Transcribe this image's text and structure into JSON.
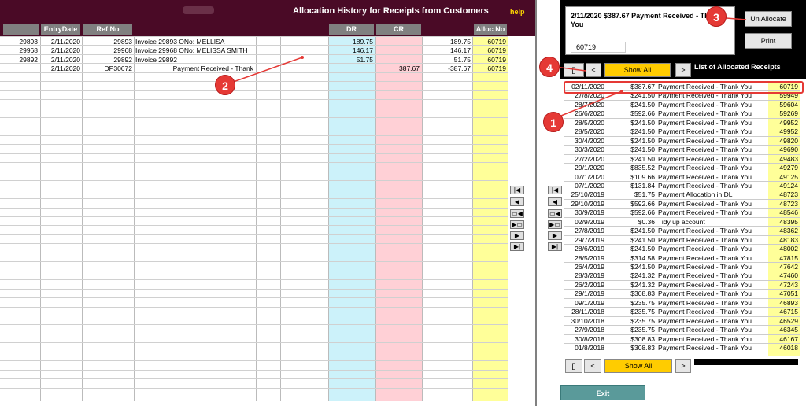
{
  "header": {
    "title": "Allocation History for Receipts from Customers",
    "help": "help"
  },
  "columns": {
    "entry_date": "EntryDate",
    "ref_no": "Ref No",
    "dr": "DR",
    "cr": "CR",
    "alloc_no": "Alloc No"
  },
  "left_rows": [
    {
      "id": "29893",
      "date": "2/11/2020",
      "ref": "29893",
      "desc": "Invoice 29893 ONo: MELLISA",
      "dr": "189.75",
      "cr": "",
      "bal": "189.75",
      "alloc": "60719"
    },
    {
      "id": "29968",
      "date": "2/11/2020",
      "ref": "29968",
      "desc": "Invoice 29968 ONo: MELISSA SMITH",
      "dr": "146.17",
      "cr": "",
      "bal": "146.17",
      "alloc": "60719"
    },
    {
      "id": "29892",
      "date": "2/11/2020",
      "ref": "29892",
      "desc": "Invoice 29892",
      "dr": "51.75",
      "cr": "",
      "bal": "51.75",
      "alloc": "60719"
    },
    {
      "id": "",
      "date": "2/11/2020",
      "ref": "DP30672",
      "desc": "Payment Received - Thank",
      "dr": "",
      "cr": "387.67",
      "bal": "-387.67",
      "alloc": "60719"
    }
  ],
  "info": {
    "line1": "2/11/2020 $387.67 Payment Received - Thank",
    "line2": "You",
    "alloc_value": "60719"
  },
  "buttons": {
    "unallocate": "Un Allocate",
    "print": "Print",
    "bracket": "[]",
    "less": "<",
    "show_all": "Show All",
    "greater": ">",
    "exit": "Exit"
  },
  "list_title": "List of Allocated Receipts",
  "receipts": [
    {
      "date": "02/11/2020",
      "amt": "$387.67",
      "desc": "Payment Received - Thank You",
      "alloc": "60719"
    },
    {
      "date": "27/8/2020",
      "amt": "$241.50",
      "desc": "Payment Received - Thank You",
      "alloc": "59949"
    },
    {
      "date": "28/7/2020",
      "amt": "$241.50",
      "desc": "Payment Received - Thank You",
      "alloc": "59604"
    },
    {
      "date": "26/6/2020",
      "amt": "$592.66",
      "desc": "Payment Received - Thank You",
      "alloc": "59269"
    },
    {
      "date": "28/5/2020",
      "amt": "$241.50",
      "desc": "Payment Received - Thank You",
      "alloc": "49952"
    },
    {
      "date": "28/5/2020",
      "amt": "$241.50",
      "desc": "Payment Received - Thank You",
      "alloc": "49952"
    },
    {
      "date": "30/4/2020",
      "amt": "$241.50",
      "desc": "Payment Received - Thank You",
      "alloc": "49820"
    },
    {
      "date": "30/3/2020",
      "amt": "$241.50",
      "desc": "Payment Received - Thank You",
      "alloc": "49690"
    },
    {
      "date": "27/2/2020",
      "amt": "$241.50",
      "desc": "Payment Received - Thank You",
      "alloc": "49483"
    },
    {
      "date": "29/1/2020",
      "amt": "$835.52",
      "desc": "Payment Received - Thank You",
      "alloc": "49279"
    },
    {
      "date": "07/1/2020",
      "amt": "$109.66",
      "desc": "Payment Received - Thank You",
      "alloc": "49125"
    },
    {
      "date": "07/1/2020",
      "amt": "$131.84",
      "desc": "Payment Received - Thank You",
      "alloc": "49124"
    },
    {
      "date": "25/10/2019",
      "amt": "$51.75",
      "desc": "Payment Allocation in DL",
      "alloc": "48723"
    },
    {
      "date": "29/10/2019",
      "amt": "$592.66",
      "desc": "Payment Received - Thank You",
      "alloc": "48723"
    },
    {
      "date": "30/9/2019",
      "amt": "$592.66",
      "desc": "Payment Received - Thank You",
      "alloc": "48546"
    },
    {
      "date": "02/9/2019",
      "amt": "$0.36",
      "desc": "Tidy up account",
      "alloc": "48395"
    },
    {
      "date": "27/8/2019",
      "amt": "$241.50",
      "desc": "Payment Received - Thank You",
      "alloc": "48362"
    },
    {
      "date": "29/7/2019",
      "amt": "$241.50",
      "desc": "Payment Received - Thank You",
      "alloc": "48183"
    },
    {
      "date": "28/6/2019",
      "amt": "$241.50",
      "desc": "Payment Received - Thank You",
      "alloc": "48002"
    },
    {
      "date": "28/5/2019",
      "amt": "$314.58",
      "desc": "Payment Received - Thank You",
      "alloc": "47815"
    },
    {
      "date": "26/4/2019",
      "amt": "$241.50",
      "desc": "Payment Received - Thank You",
      "alloc": "47642"
    },
    {
      "date": "28/3/2019",
      "amt": "$241.32",
      "desc": "Payment Received - Thank You",
      "alloc": "47460"
    },
    {
      "date": "26/2/2019",
      "amt": "$241.32",
      "desc": "Payment Received - Thank You",
      "alloc": "47243"
    },
    {
      "date": "29/1/2019",
      "amt": "$308.83",
      "desc": "Payment Received - Thank You",
      "alloc": "47051"
    },
    {
      "date": "09/1/2019",
      "amt": "$235.75",
      "desc": "Payment Received - Thank You",
      "alloc": "46893"
    },
    {
      "date": "28/11/2018",
      "amt": "$235.75",
      "desc": "Payment Received - Thank You",
      "alloc": "46715"
    },
    {
      "date": "30/10/2018",
      "amt": "$235.75",
      "desc": "Payment Received - Thank You",
      "alloc": "46529"
    },
    {
      "date": "27/9/2018",
      "amt": "$235.75",
      "desc": "Payment Received - Thank You",
      "alloc": "46345"
    },
    {
      "date": "30/8/2018",
      "amt": "$308.83",
      "desc": "Payment Received - Thank You",
      "alloc": "46167"
    },
    {
      "date": "01/8/2018",
      "amt": "$308.83",
      "desc": "Payment Received - Thank You",
      "alloc": "46018"
    }
  ],
  "callouts": [
    "1",
    "2",
    "3",
    "4"
  ],
  "colors": {
    "header_bg": "#4a0a26",
    "dr_fill": "#ccf2fa",
    "cr_fill": "#ffd0d6",
    "alloc_fill": "#ffff99",
    "callout": "#e53935"
  }
}
